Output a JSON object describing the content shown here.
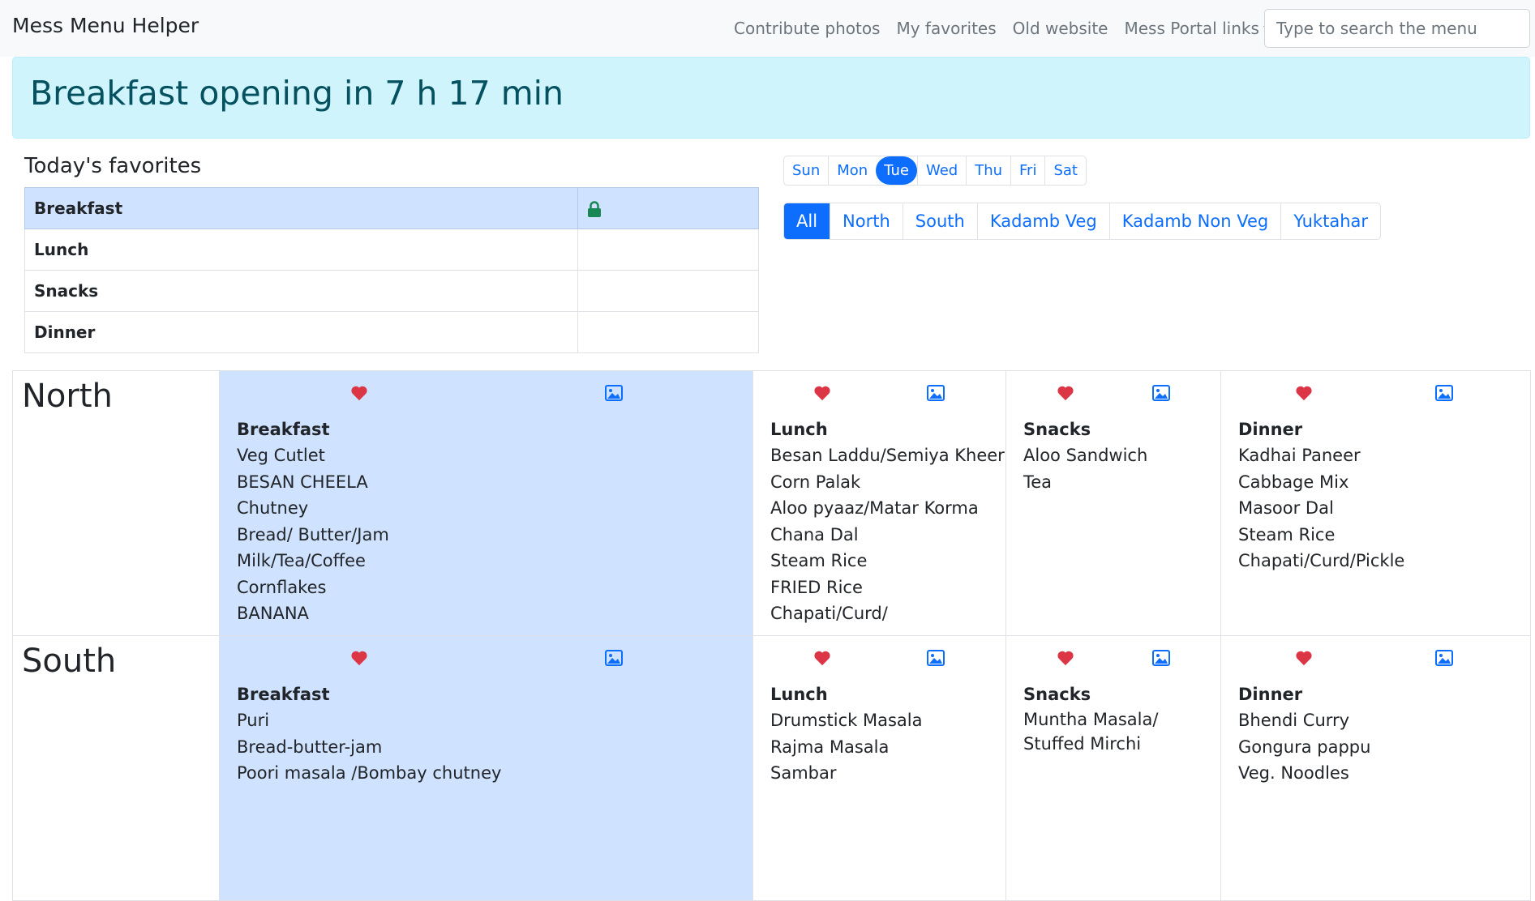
{
  "navbar": {
    "brand": "Mess Menu Helper",
    "links": [
      "Contribute photos",
      "My favorites",
      "Old website"
    ],
    "dropdown_label": "Mess Portal links",
    "search_placeholder": "Type to search the menu"
  },
  "alert": {
    "text": "Breakfast opening in 7 h 17 min"
  },
  "favorites": {
    "title": "Today's favorites",
    "meals": [
      "Breakfast",
      "Lunch",
      "Snacks",
      "Dinner"
    ]
  },
  "days": [
    "Sun",
    "Mon",
    "Tue",
    "Wed",
    "Thu",
    "Fri",
    "Sat"
  ],
  "active_day": "Tue",
  "messes": [
    "All",
    "North",
    "South",
    "Kadamb Veg",
    "Kadamb Non Veg",
    "Yuktahar"
  ],
  "active_mess": "All",
  "colors": {
    "primary": "#0d6efd",
    "heart": "#dc3545",
    "lock": "#198754",
    "highlight": "#cfe2ff",
    "alert_bg": "#cff4fc",
    "alert_text": "#055160"
  },
  "menu": {
    "north": {
      "name": "North",
      "breakfast": {
        "title": "Breakfast",
        "items": [
          "Veg Cutlet",
          "BESAN CHEELA",
          "Chutney",
          "Bread/ Butter/Jam",
          "Milk/Tea/Coffee",
          "Cornflakes",
          "BANANA"
        ]
      },
      "lunch": {
        "title": "Lunch",
        "items": [
          "Besan Laddu/Semiya Kheer",
          "Corn Palak",
          "Aloo pyaaz/Matar Korma",
          "Chana Dal",
          "Steam Rice",
          "FRIED Rice",
          "Chapati/Curd/"
        ]
      },
      "snacks": {
        "title": "Snacks",
        "items": [
          "Aloo Sandwich",
          "Tea"
        ]
      },
      "dinner": {
        "title": "Dinner",
        "items": [
          "Kadhai Paneer",
          "Cabbage Mix",
          "Masoor Dal",
          "Steam Rice",
          "Chapati/Curd/Pickle"
        ]
      }
    },
    "south": {
      "name": "South",
      "breakfast": {
        "title": "Breakfast",
        "items": [
          "Puri",
          "Bread-butter-jam",
          "Poori masala /Bombay chutney"
        ]
      },
      "lunch": {
        "title": "Lunch",
        "items": [
          "Drumstick Masala",
          "Rajma Masala",
          "Sambar"
        ]
      },
      "snacks": {
        "title": "Snacks",
        "items": [
          "Muntha Masala/ Stuffed Mirchi"
        ]
      },
      "dinner": {
        "title": "Dinner",
        "items": [
          "Bhendi Curry",
          "Gongura pappu",
          "Veg. Noodles"
        ]
      }
    }
  }
}
